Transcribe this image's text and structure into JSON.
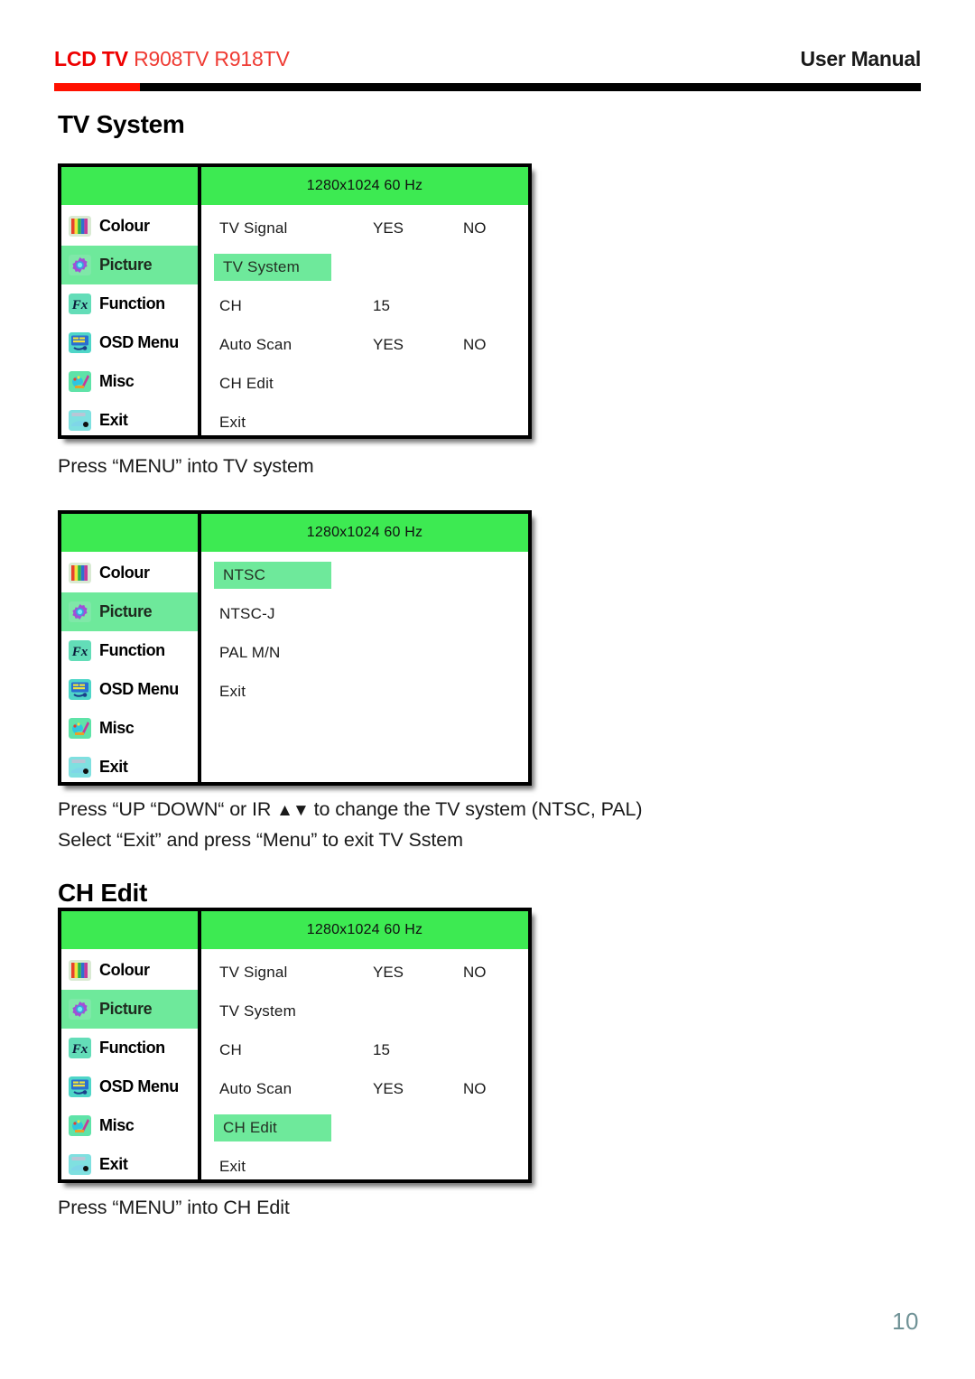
{
  "header": {
    "lcd_tv": "LCD TV",
    "models": "R908TV R918TV",
    "right_label": "User Manual",
    "rule_red_color": "#ff1100",
    "rule_black_color": "#000000"
  },
  "sections": {
    "tv_system_title": "TV System",
    "ch_edit_title": "CH Edit"
  },
  "paragraphs": {
    "menu_into_tv_system": "Press “MENU” into TV system",
    "updown_line_pre": "Press “UP “DOWN“ or IR ",
    "updown_arrows": "▲▼",
    "updown_line_post": " to change the TV system (NTSC, PAL)",
    "select_exit_line": "Select “Exit” and press “Menu” to exit TV Sstem",
    "menu_into_ch_edit": "Press “MENU” into CH Edit"
  },
  "osd_common": {
    "resolution_label": "1280x1024  60 Hz",
    "header_green": "#3dea52",
    "highlight_green": "#6ee99b",
    "sidebar_items": [
      {
        "label": "Colour",
        "icon": "colour-bars-icon",
        "selected": false
      },
      {
        "label": "Picture",
        "icon": "picture-gear-icon",
        "selected": true
      },
      {
        "label": "Function",
        "icon": "function-fx-icon",
        "selected": false
      },
      {
        "label": "OSD Menu",
        "icon": "osd-screen-icon",
        "selected": false
      },
      {
        "label": "Misc",
        "icon": "misc-palette-icon",
        "selected": false
      },
      {
        "label": "Exit",
        "icon": "exit-door-icon",
        "selected": false
      }
    ]
  },
  "osd_panels": [
    {
      "name": "tv-system-menu",
      "rows": [
        {
          "label": "TV Signal",
          "val1": "YES",
          "val2": "NO",
          "selected": false
        },
        {
          "label": "TV System",
          "val1": "",
          "val2": "",
          "selected": true
        },
        {
          "label": "CH",
          "val1": "15",
          "val2": "",
          "selected": false
        },
        {
          "label": "Auto Scan",
          "val1": "YES",
          "val2": "NO",
          "selected": false
        },
        {
          "label": "CH Edit",
          "val1": "",
          "val2": "",
          "selected": false
        },
        {
          "label": "Exit",
          "val1": "",
          "val2": "",
          "selected": false
        }
      ]
    },
    {
      "name": "tv-system-standards-menu",
      "rows": [
        {
          "label": "NTSC",
          "val1": "",
          "val2": "",
          "selected": true
        },
        {
          "label": "NTSC-J",
          "val1": "",
          "val2": "",
          "selected": false
        },
        {
          "label": "PAL M/N",
          "val1": "",
          "val2": "",
          "selected": false
        },
        {
          "label": "Exit",
          "val1": "",
          "val2": "",
          "selected": false
        }
      ]
    },
    {
      "name": "ch-edit-menu",
      "rows": [
        {
          "label": "TV Signal",
          "val1": "YES",
          "val2": "NO",
          "selected": false
        },
        {
          "label": "TV System",
          "val1": "",
          "val2": "",
          "selected": false
        },
        {
          "label": "CH",
          "val1": "15",
          "val2": "",
          "selected": false
        },
        {
          "label": "Auto Scan",
          "val1": "YES",
          "val2": "NO",
          "selected": false
        },
        {
          "label": "CH Edit",
          "val1": "",
          "val2": "",
          "selected": true
        },
        {
          "label": "Exit",
          "val1": "",
          "val2": "",
          "selected": false
        }
      ]
    }
  ],
  "footer": {
    "page_number": "10"
  }
}
